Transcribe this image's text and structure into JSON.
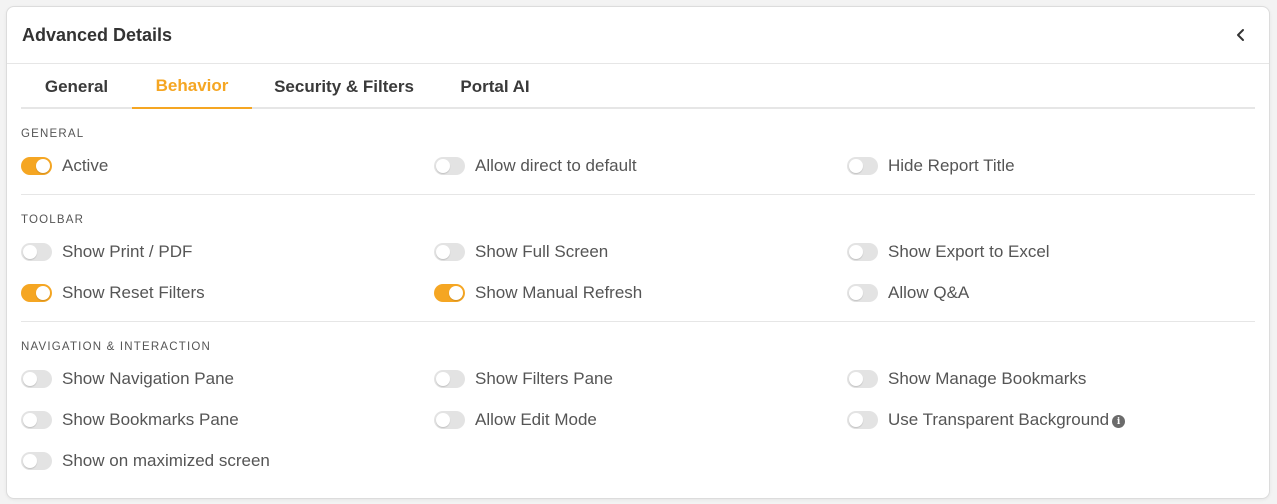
{
  "header": {
    "title": "Advanced Details"
  },
  "tabs": [
    {
      "label": "General",
      "active": false
    },
    {
      "label": "Behavior",
      "active": true
    },
    {
      "label": "Security & Filters",
      "active": false
    },
    {
      "label": "Portal AI",
      "active": false
    }
  ],
  "colors": {
    "accent": "#f5a623",
    "toggle_off": "#e3e3e3"
  },
  "sections": {
    "general": {
      "title": "GENERAL",
      "items": [
        {
          "label": "Active",
          "on": true
        },
        {
          "label": "Allow direct to default",
          "on": false
        },
        {
          "label": "Hide Report Title",
          "on": false
        }
      ]
    },
    "toolbar": {
      "title": "TOOLBAR",
      "items": [
        {
          "label": "Show Print / PDF",
          "on": false
        },
        {
          "label": "Show Full Screen",
          "on": false
        },
        {
          "label": "Show Export to Excel",
          "on": false
        },
        {
          "label": "Show Reset Filters",
          "on": true
        },
        {
          "label": "Show Manual Refresh",
          "on": true
        },
        {
          "label": "Allow Q&A",
          "on": false
        }
      ]
    },
    "navigation": {
      "title": "NAVIGATION & INTERACTION",
      "items": [
        {
          "label": "Show Navigation Pane",
          "on": false
        },
        {
          "label": "Show Filters Pane",
          "on": false
        },
        {
          "label": "Show Manage Bookmarks",
          "on": false
        },
        {
          "label": "Show Bookmarks Pane",
          "on": false
        },
        {
          "label": "Allow Edit Mode",
          "on": false
        },
        {
          "label": "Use Transparent Background",
          "on": false,
          "info_icon": true
        },
        {
          "label": "Show on maximized screen",
          "on": false
        }
      ]
    }
  }
}
